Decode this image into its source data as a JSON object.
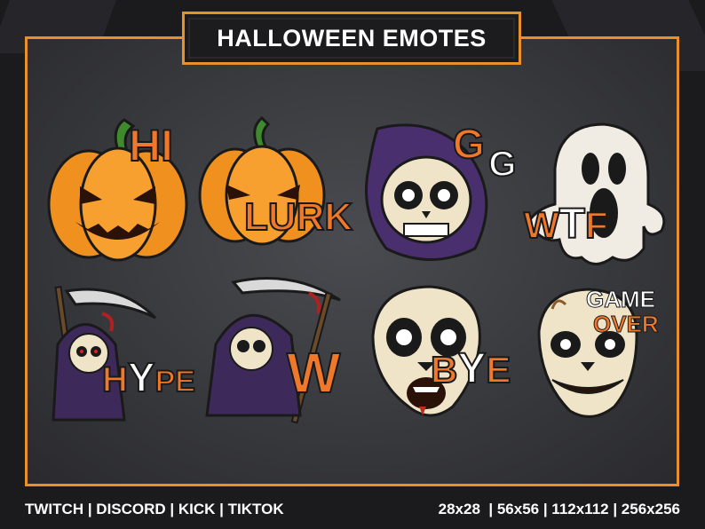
{
  "header": {
    "title": "HALLOWEEN EMOTES"
  },
  "emotes": [
    {
      "label": "HI",
      "icon": "pumpkin-icon"
    },
    {
      "label": "LURK",
      "icon": "pumpkin-icon"
    },
    {
      "label_a": "G",
      "label_b": "G",
      "icon": "reaper-skull-icon"
    },
    {
      "label_a": "W",
      "label_b": "T",
      "label_c": "F",
      "icon": "ghost-icon"
    },
    {
      "label_a": "H",
      "label_b": "Y",
      "label_c": "PE",
      "icon": "reaper-scythe-icon"
    },
    {
      "label": "W",
      "icon": "reaper-scythe-icon"
    },
    {
      "label_a": "B",
      "label_b": "Y",
      "label_c": "E",
      "icon": "skull-mask-icon"
    },
    {
      "label_a": "GAME",
      "label_b": "OVER",
      "icon": "zombie-skull-icon"
    }
  ],
  "footer": {
    "platforms": "TWITCH | DISCORD | KICK | TIKTOK",
    "sizes": "28x28  | 56x56 | 112x112 | 256x256"
  },
  "colors": {
    "accent": "#e8902a",
    "text_orange": "#f0782a",
    "text_red": "#c42a1c",
    "pumpkin": "#f0901e",
    "hood": "#4a2f6e"
  }
}
